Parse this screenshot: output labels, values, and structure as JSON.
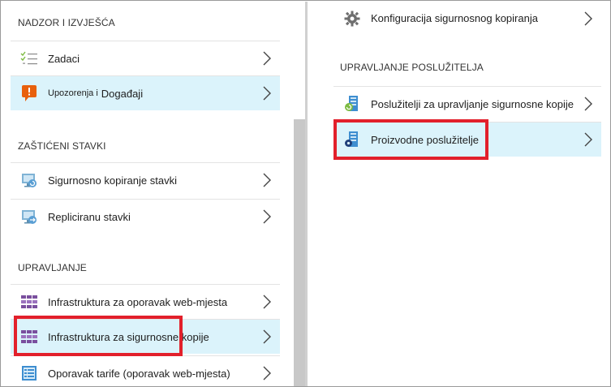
{
  "left": {
    "sections": [
      {
        "header": "NADZOR I IZVJEŠĆA",
        "items": [
          {
            "label": "Zadaci",
            "icon": "task-list-icon"
          },
          {
            "label_small": "Upozorenja i",
            "label": "Događaji",
            "icon": "alert-icon"
          }
        ]
      },
      {
        "header": "ZAŠTIĆENI STAVKI",
        "items": [
          {
            "label": "Sigurnosno kopiranje stavki",
            "icon": "backup-items-icon"
          },
          {
            "label": "Repliciranu stavki",
            "icon": "replicated-items-icon"
          }
        ]
      },
      {
        "header": "UPRAVLJANJE",
        "items": [
          {
            "label": "Infrastruktura za oporavak web-mjesta",
            "icon": "site-recovery-infra-icon"
          },
          {
            "label": "Infrastruktura za sigurnosne kopije",
            "icon": "backup-infra-icon"
          },
          {
            "label": "Oporavak tarife (oporavak web-mjesta)",
            "icon": "recovery-plan-icon"
          }
        ]
      }
    ]
  },
  "right": {
    "top_item": {
      "label": "Konfiguracija sigurnosnog kopiranja",
      "icon": "gear-icon"
    },
    "sections": [
      {
        "header": "UPRAVLJANJE POSLUŽITELJA",
        "items": [
          {
            "label": "Poslužitelji za upravljanje sigurnosne kopije",
            "icon": "backup-servers-icon"
          },
          {
            "label": "Proizvodne poslužitelje",
            "icon": "production-servers-icon"
          }
        ]
      }
    ]
  },
  "colors": {
    "selected_bg": "#dbf3fb",
    "highlight": "#e2202b",
    "alert_orange": "#e8600c",
    "infra_purple": "#7a4f9e"
  }
}
